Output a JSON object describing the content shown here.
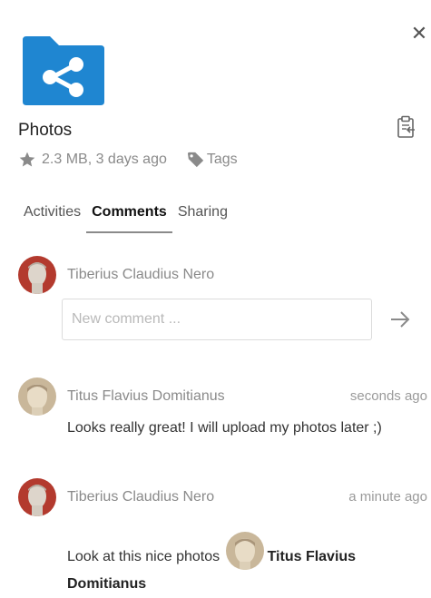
{
  "file": {
    "name": "Photos",
    "size": "2.3 MB",
    "modified": "3 days ago",
    "tags_label": "Tags"
  },
  "tabs": [
    {
      "label": "Activities"
    },
    {
      "label": "Comments",
      "active": true
    },
    {
      "label": "Sharing"
    }
  ],
  "composer": {
    "author": "Tiberius Claudius Nero",
    "placeholder": "New comment ..."
  },
  "comments": [
    {
      "author": "Titus Flavius Domitianus",
      "timestamp": "seconds ago",
      "message": "Looks really great! I will upload my photos later ;)"
    },
    {
      "author": "Tiberius Claudius Nero",
      "timestamp": "a minute ago",
      "message_prefix": "Look at this nice photos",
      "mention_first": "Titus Flavius",
      "mention_last": "Domitianus"
    }
  ],
  "icons": {
    "close": "close-icon",
    "folder": "shared-folder-icon",
    "clipboard": "clipboard-icon",
    "star": "star-icon",
    "tag": "tag-icon",
    "send": "arrow-right-icon"
  },
  "colors": {
    "folder_blue": "#1f86d1",
    "accent_underline": "#8a8a8a",
    "muted_text": "#8a8a8a",
    "avatar_red": "#b33a2e",
    "avatar_tan": "#c9b79a"
  }
}
